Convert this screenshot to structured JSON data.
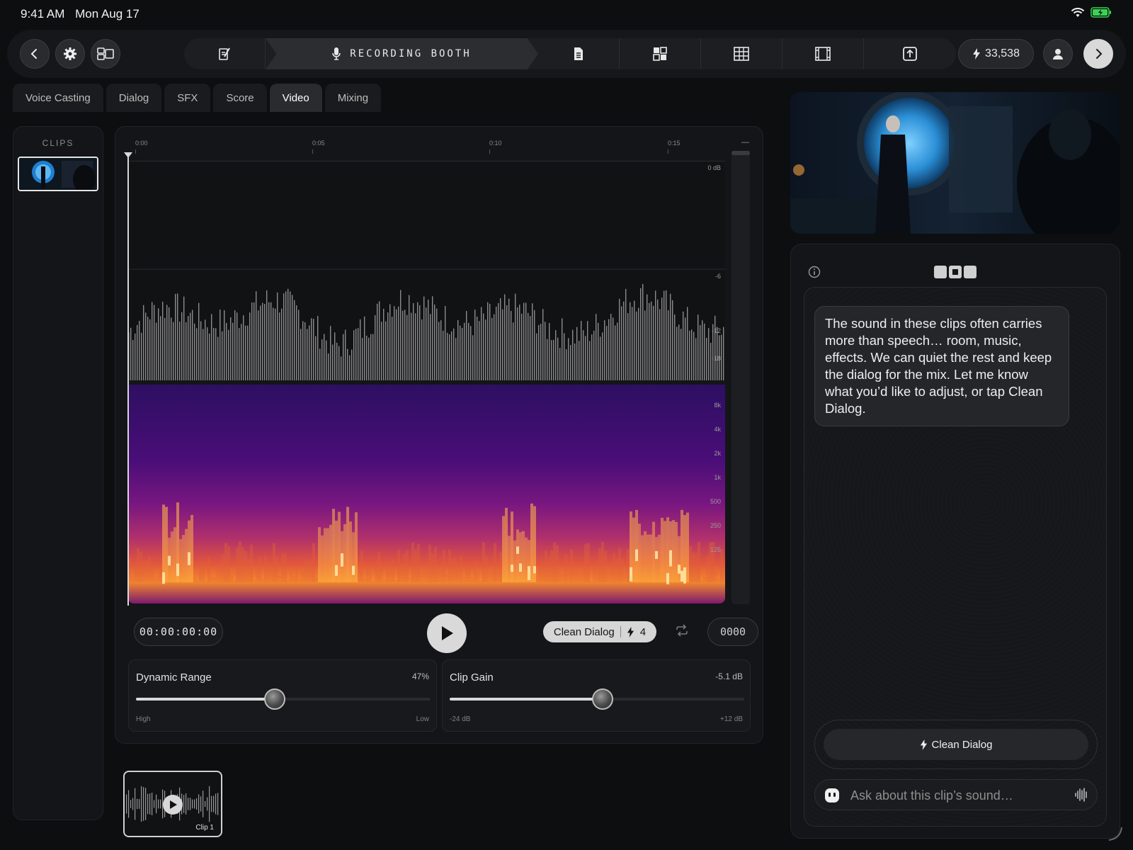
{
  "status_bar": {
    "time": "9:41 AM",
    "date": "Mon Aug 17"
  },
  "toolbar": {
    "active_step_label": "RECORDING BOOTH",
    "credits": "33,538",
    "steps": [
      "script-edit",
      "recording-booth",
      "document",
      "storyboard",
      "grid",
      "film",
      "export"
    ]
  },
  "tabs": [
    {
      "label": "Voice Casting",
      "active": false
    },
    {
      "label": "Dialog",
      "active": false
    },
    {
      "label": "SFX",
      "active": false
    },
    {
      "label": "Score",
      "active": false
    },
    {
      "label": "Video",
      "active": true
    },
    {
      "label": "Mixing",
      "active": false
    }
  ],
  "clips_panel": {
    "title": "CLIPS"
  },
  "timeline": {
    "ticks": [
      "0:00",
      "0:05",
      "0:10",
      "0:15"
    ],
    "end_marker": "—",
    "db_labels": [
      "0 dB",
      "-6",
      "-12",
      "-18"
    ],
    "freq_labels": [
      "8k",
      "4k",
      "2k",
      "1k",
      "500",
      "250",
      "125"
    ]
  },
  "transport": {
    "timecode": "00:00:00:00",
    "clean_dialog_label": "Clean Dialog",
    "clean_dialog_cost": "4",
    "counter": "0000"
  },
  "sliders": {
    "dynamic_range": {
      "label": "Dynamic Range",
      "value": "47%",
      "fraction": 0.47,
      "low_label": "High",
      "high_label": "Low"
    },
    "clip_gain": {
      "label": "Clip Gain",
      "value": "-5.1 dB",
      "fraction": 0.52,
      "low_label": "-24 dB",
      "high_label": "+12 dB"
    }
  },
  "clip_strip": {
    "label": "Clip 1"
  },
  "assistant": {
    "message": "The sound in these clips often carries more than speech… room, music, effects. We can quiet the rest and keep the dialog for the mix. Let me know what you’d like to adjust, or tap Clean Dialog.",
    "action_label": "Clean Dialog",
    "input_placeholder": "Ask about this clip’s sound…"
  },
  "colors": {
    "accent": "#d9d9d9",
    "background": "#0d0e10",
    "panel": "#141518",
    "battery": "#39d353"
  }
}
